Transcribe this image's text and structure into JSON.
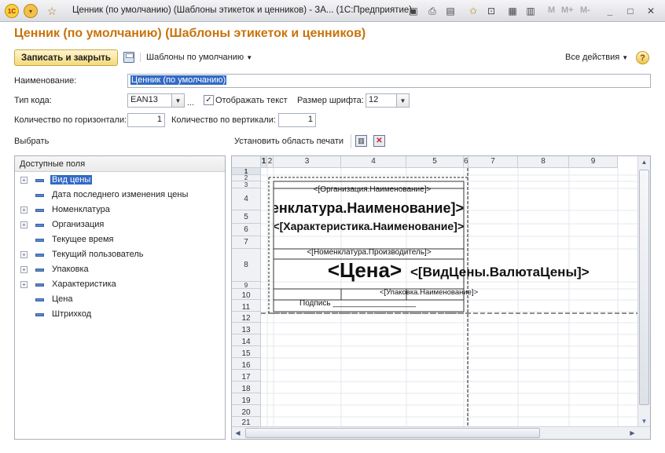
{
  "window": {
    "title": "Ценник (по умолчанию) (Шаблоны этикеток и ценников) - ЗА... (1С:Предприятие)",
    "logo_text": "1С",
    "buttons": {
      "m": "M",
      "m_plus": "M+",
      "m_minus": "M-",
      "minimize": "_",
      "maximize": "□",
      "close": "✕"
    }
  },
  "form": {
    "title": "Ценник (по умолчанию) (Шаблоны этикеток и ценников)",
    "toolbar": {
      "save_close": "Записать и закрыть",
      "templates_menu": "Шаблоны по умолчанию",
      "all_actions": "Все действия",
      "help": "?"
    },
    "name_label": "Наименование:",
    "name_value": "Ценник (по умолчанию)",
    "code_type_label": "Тип кода:",
    "code_type_value": "EAN13",
    "show_text_label": "Отображать текст",
    "show_text_checked": true,
    "font_size_label": "Размер шрифта:",
    "font_size_value": "12",
    "horiz_count_label": "Количество по горизонтали:",
    "horiz_count_value": "1",
    "vert_count_label": "Количество по вертикали:",
    "vert_count_value": "1",
    "choose_label": "Выбрать",
    "set_print_area_label": "Установить область печати",
    "dots": "..."
  },
  "fields": {
    "header": "Доступные поля",
    "items": [
      {
        "label": "Вид цены",
        "expandable": true,
        "selected": true
      },
      {
        "label": "Дата последнего изменения цены",
        "expandable": false,
        "selected": false
      },
      {
        "label": "Номенклатура",
        "expandable": true,
        "selected": false
      },
      {
        "label": "Организация",
        "expandable": true,
        "selected": false
      },
      {
        "label": "Текущее время",
        "expandable": false,
        "selected": false
      },
      {
        "label": "Текущий пользователь",
        "expandable": true,
        "selected": false
      },
      {
        "label": "Упаковка",
        "expandable": true,
        "selected": false
      },
      {
        "label": "Характеристика",
        "expandable": true,
        "selected": false
      },
      {
        "label": "Цена",
        "expandable": false,
        "selected": false
      },
      {
        "label": "Штрихкод",
        "expandable": false,
        "selected": false
      }
    ]
  },
  "sheet": {
    "columns": [
      "1",
      "2",
      "3",
      "4",
      "5",
      "6",
      "7",
      "8",
      "9"
    ],
    "rows": [
      "1",
      "2",
      "3",
      "4",
      "5",
      "6",
      "7",
      "8",
      "9",
      "10",
      "11",
      "12",
      "13",
      "14",
      "15",
      "16",
      "17",
      "18",
      "19",
      "20",
      "21"
    ],
    "cells": {
      "org": "<[Организация.Наименование]>",
      "nom": "<[Номенклатура.Наименование]>",
      "char": "<[Характеристика.Наименование]>",
      "producer": "<[Номенклатура.Производитель]>",
      "price": "<Цена>",
      "currency": "<[ВидЦены.ВалютаЦены]>",
      "pack": "<[Упаковка.Наименование]>",
      "sign": "Подпись ___________________"
    }
  }
}
